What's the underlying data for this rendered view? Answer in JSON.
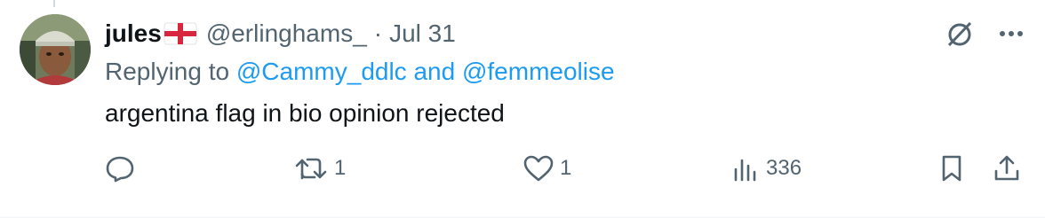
{
  "tweet": {
    "display_name": "jules",
    "handle": "@erlinghams_",
    "separator": "·",
    "date": "Jul 31",
    "replying_prefix": "Replying to",
    "mention_1": "@Cammy_ddlc",
    "mention_joiner": "and",
    "mention_2": "@femmeolise",
    "text": "argentina flag in bio opinion rejected"
  },
  "actions": {
    "retweets": "1",
    "likes": "1",
    "views": "336"
  },
  "icons": {
    "flag": "england-flag-icon",
    "grok": "grok-icon",
    "more": "more-icon",
    "reply": "reply-icon",
    "retweet": "retweet-icon",
    "like": "heart-icon",
    "views": "views-icon",
    "bookmark": "bookmark-icon",
    "share": "share-icon"
  },
  "colors": {
    "text": "#0f1419",
    "secondary": "#536471",
    "link": "#1d9bf0"
  }
}
